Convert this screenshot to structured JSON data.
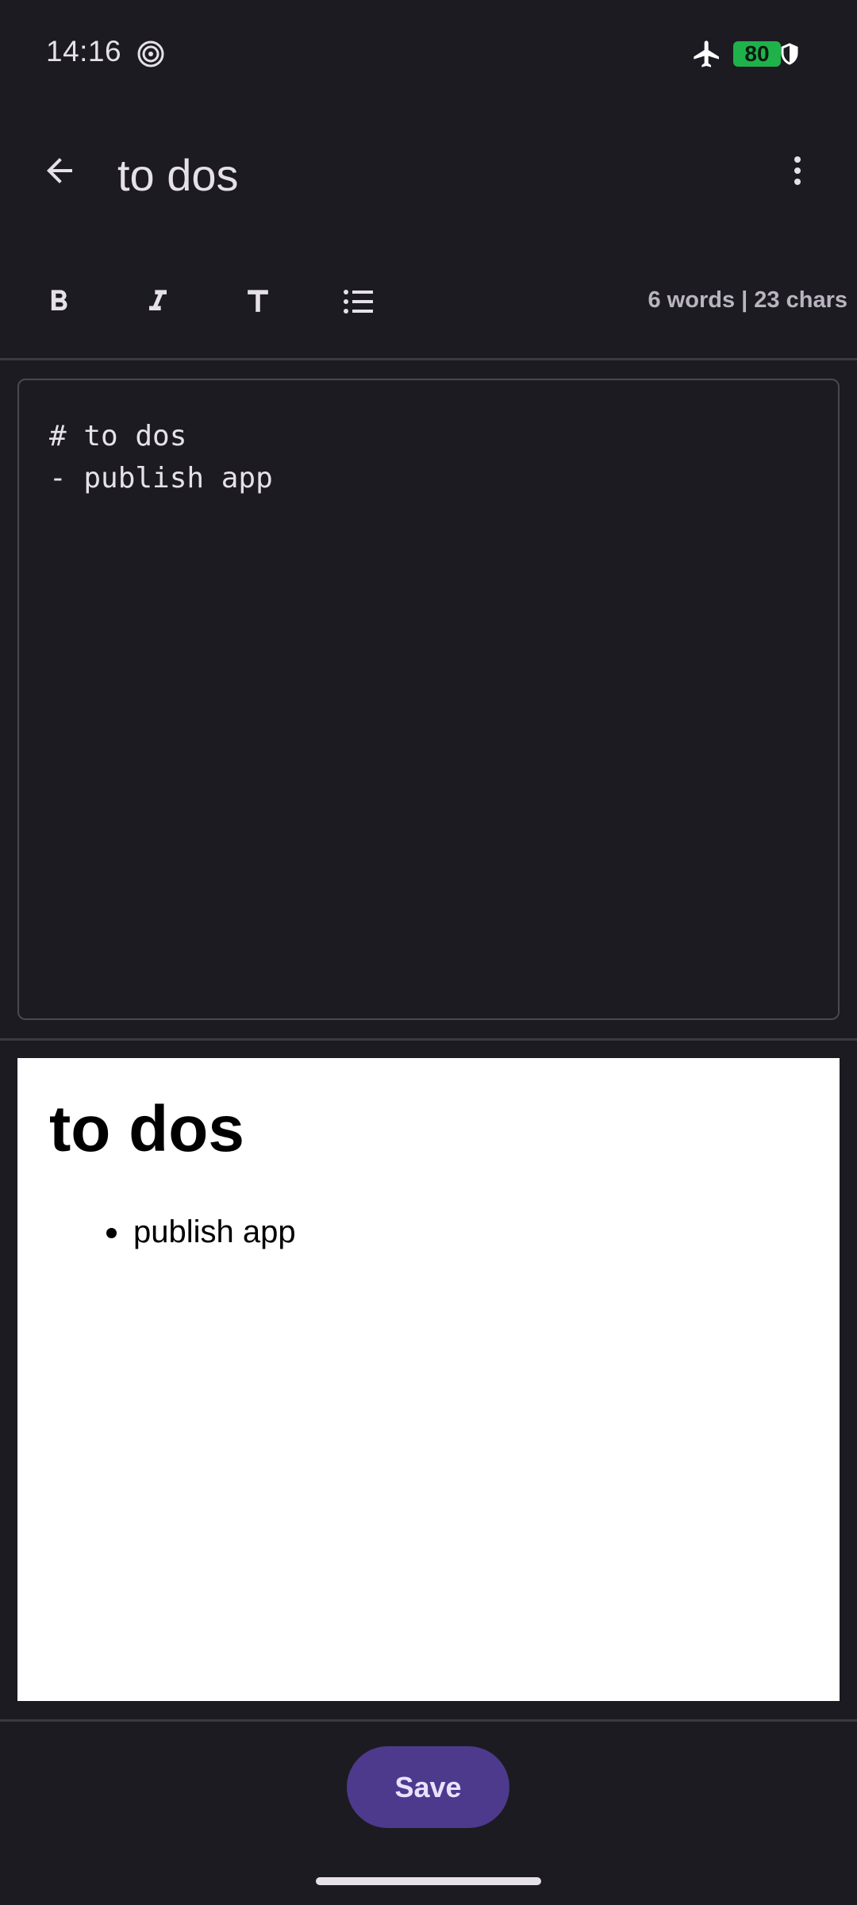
{
  "status_bar": {
    "time": "14:16",
    "battery_level": "80",
    "battery_color": "#1fb24a",
    "icons": [
      "signal-ring-icon",
      "airplane-mode-icon",
      "battery-icon",
      "shield-icon"
    ]
  },
  "app_bar": {
    "title": "to dos",
    "back_icon": "arrow-left-icon",
    "menu_icon": "more-vertical-icon"
  },
  "toolbar": {
    "tools": [
      "bold-icon",
      "italic-icon",
      "heading-icon",
      "bulleted-list-icon"
    ],
    "counter": "6 words | 23 chars"
  },
  "editor": {
    "line1": "# to dos",
    "line2": "- publish app"
  },
  "preview": {
    "heading": "to dos",
    "items": [
      "publish app"
    ]
  },
  "footer": {
    "save_label": "Save",
    "accent": "#4d3a8c"
  }
}
